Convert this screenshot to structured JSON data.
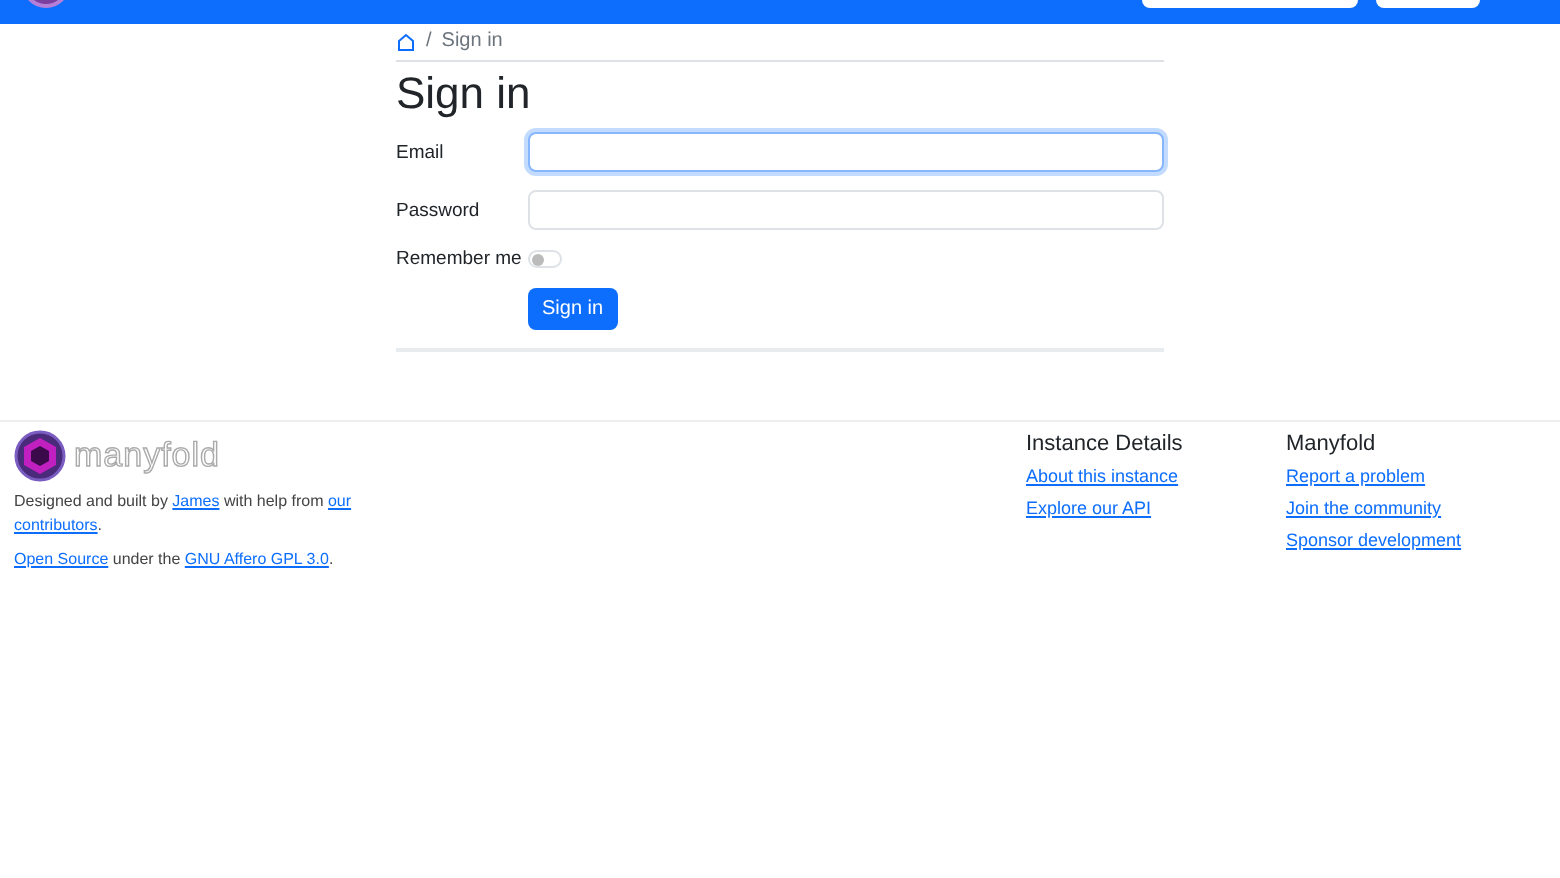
{
  "breadcrumb": {
    "separator": "/",
    "current": "Sign in"
  },
  "title": "Sign in",
  "form": {
    "fields": [
      {
        "label": "Email",
        "focused": true
      },
      {
        "label": "Password",
        "focused": false
      }
    ],
    "remember": {
      "label": "Remember me",
      "on": false
    },
    "submit": "Sign in"
  },
  "footer": {
    "logo_text": "manyfold",
    "paragraphs": [
      [
        {
          "text": "Designed and built by ",
          "link": false
        },
        {
          "text": "James",
          "link": true
        },
        {
          "text": " with help from ",
          "link": false
        },
        {
          "text": "our",
          "link": true
        },
        {
          "text": "contributors",
          "link": true
        },
        {
          "text": ".",
          "link": false
        }
      ],
      [
        {
          "text": "Open Source",
          "link": true
        },
        {
          "text": " under the ",
          "link": false
        },
        {
          "text": "GNU Affero GPL 3.0",
          "link": true
        },
        {
          "text": ".",
          "link": false
        }
      ]
    ],
    "columns": [
      {
        "heading": "Instance Details",
        "links": [
          "About this instance",
          "Explore our API"
        ]
      },
      {
        "heading": "Manyfold",
        "links": [
          "Report a problem",
          "Join the community",
          "Sponsor development"
        ]
      }
    ]
  }
}
